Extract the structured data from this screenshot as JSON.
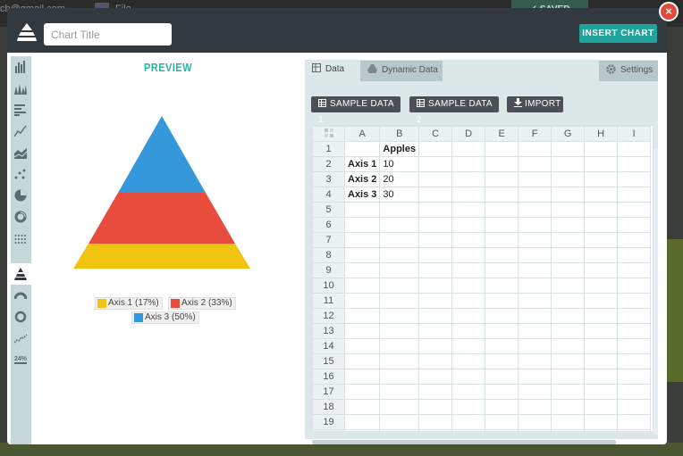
{
  "background": {
    "email": "ch@gmail.com",
    "file_menu": "File",
    "saved_label": "SAVED"
  },
  "header": {
    "title_placeholder": "Chart Title",
    "insert_label": "INSERT CHART",
    "close_glyph": "×"
  },
  "sidebar": {
    "items": [
      {
        "icon": "column-chart-icon"
      },
      {
        "icon": "stacked-column-chart-icon"
      },
      {
        "icon": "bar-chart-icon"
      },
      {
        "icon": "line-chart-icon"
      },
      {
        "icon": "area-chart-icon"
      },
      {
        "icon": "scatter-chart-icon"
      },
      {
        "icon": "pie-chart-icon"
      },
      {
        "icon": "donut-chart-icon"
      },
      {
        "icon": "dot-matrix-chart-icon"
      },
      {
        "icon": "pyramid-chart-icon",
        "active": true
      },
      {
        "icon": "gauge-chart-icon"
      },
      {
        "icon": "ring-chart-icon"
      },
      {
        "icon": "sparkline-chart-icon"
      },
      {
        "icon": "percentage-chart-icon"
      }
    ]
  },
  "preview": {
    "title": "PREVIEW",
    "legend": [
      {
        "label": "Axis 1 (17%)",
        "color": "#f1c40f"
      },
      {
        "label": "Axis 2 (33%)",
        "color": "#e74c3c"
      },
      {
        "label": "Axis 3 (50%)",
        "color": "#3498db"
      }
    ]
  },
  "chart_data": {
    "type": "pyramid",
    "categories": [
      "Axis 1",
      "Axis 2",
      "Axis 3"
    ],
    "values": [
      10,
      20,
      30
    ],
    "percentages": [
      "17%",
      "33%",
      "50%"
    ],
    "series": [
      {
        "name": "Apples",
        "values": [
          10,
          20,
          30
        ]
      }
    ],
    "colors": [
      "#f1c40f",
      "#e74c3c",
      "#3498db"
    ]
  },
  "data_panel": {
    "tabs": {
      "data": "Data",
      "dynamic": "Dynamic Data",
      "settings": "Settings"
    },
    "buttons": {
      "sample1": "SAMPLE DATA 1",
      "sample2": "SAMPLE DATA 2",
      "import": "IMPORT"
    },
    "columns": [
      "A",
      "B",
      "C",
      "D",
      "E",
      "F",
      "G",
      "H",
      "I"
    ],
    "rows": [
      [
        "",
        "Apples",
        "",
        "",
        "",
        "",
        "",
        "",
        ""
      ],
      [
        "Axis 1",
        "10",
        "",
        "",
        "",
        "",
        "",
        "",
        ""
      ],
      [
        "Axis 2",
        "20",
        "",
        "",
        "",
        "",
        "",
        "",
        ""
      ],
      [
        "Axis 3",
        "30",
        "",
        "",
        "",
        "",
        "",
        "",
        ""
      ]
    ],
    "row_count": 20
  }
}
